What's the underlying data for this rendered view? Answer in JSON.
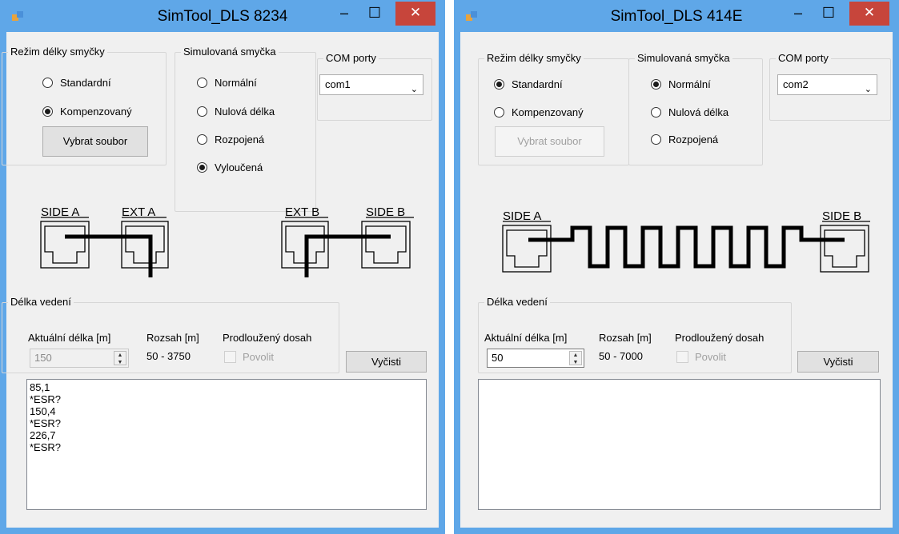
{
  "windows": [
    {
      "title": "SimTool_DLS 8234",
      "controls": {
        "minimize": "–",
        "maximize": "☐",
        "close": "✕"
      },
      "mode_group": {
        "label": "Režim délky smyčky",
        "options": [
          "Standardní",
          "Kompenzovaný"
        ],
        "selected": 1,
        "button": "Vybrat soubor"
      },
      "loop_group": {
        "label": "Simulovaná smyčka",
        "options": [
          "Normální",
          "Nulová délka",
          "Rozpojená",
          "Vyloučená"
        ],
        "selected": 3
      },
      "com_group": {
        "label": "COM porty",
        "value": "com1"
      },
      "diagram": {
        "side_a": "SIDE A",
        "ext_a": "EXT A",
        "ext_b": "EXT B",
        "side_b": "SIDE B"
      },
      "length_group": {
        "label": "Délka vedení",
        "current_label": "Aktuální délka [m]",
        "current_value": "150",
        "range_label": "Rozsah [m]",
        "range_value": "50 - 3750",
        "extended_label": "Prodloužený dosah",
        "enable_label": "Povolit"
      },
      "clear_button": "Vyčisti",
      "log_lines": [
        "85,1",
        "*ESR?",
        "150,4",
        "*ESR?",
        "226,7",
        "*ESR?"
      ]
    },
    {
      "title": "SimTool_DLS 414E",
      "controls": {
        "minimize": "–",
        "maximize": "☐",
        "close": "✕"
      },
      "mode_group": {
        "label": "Režim délky smyčky",
        "options": [
          "Standardní",
          "Kompenzovaný"
        ],
        "selected": 0,
        "button": "Vybrat soubor"
      },
      "loop_group": {
        "label": "Simulovaná smyčka",
        "options": [
          "Normální",
          "Nulová délka",
          "Rozpojená"
        ],
        "selected": 0
      },
      "com_group": {
        "label": "COM porty",
        "value": "com2"
      },
      "diagram": {
        "side_a": "SIDE A",
        "side_b": "SIDE B"
      },
      "length_group": {
        "label": "Délka vedení",
        "current_label": "Aktuální délka [m]",
        "current_value": "50",
        "range_label": "Rozsah [m]",
        "range_value": "50 - 7000",
        "extended_label": "Prodloužený dosah",
        "enable_label": "Povolit"
      },
      "clear_button": "Vyčisti",
      "log_lines": []
    }
  ]
}
